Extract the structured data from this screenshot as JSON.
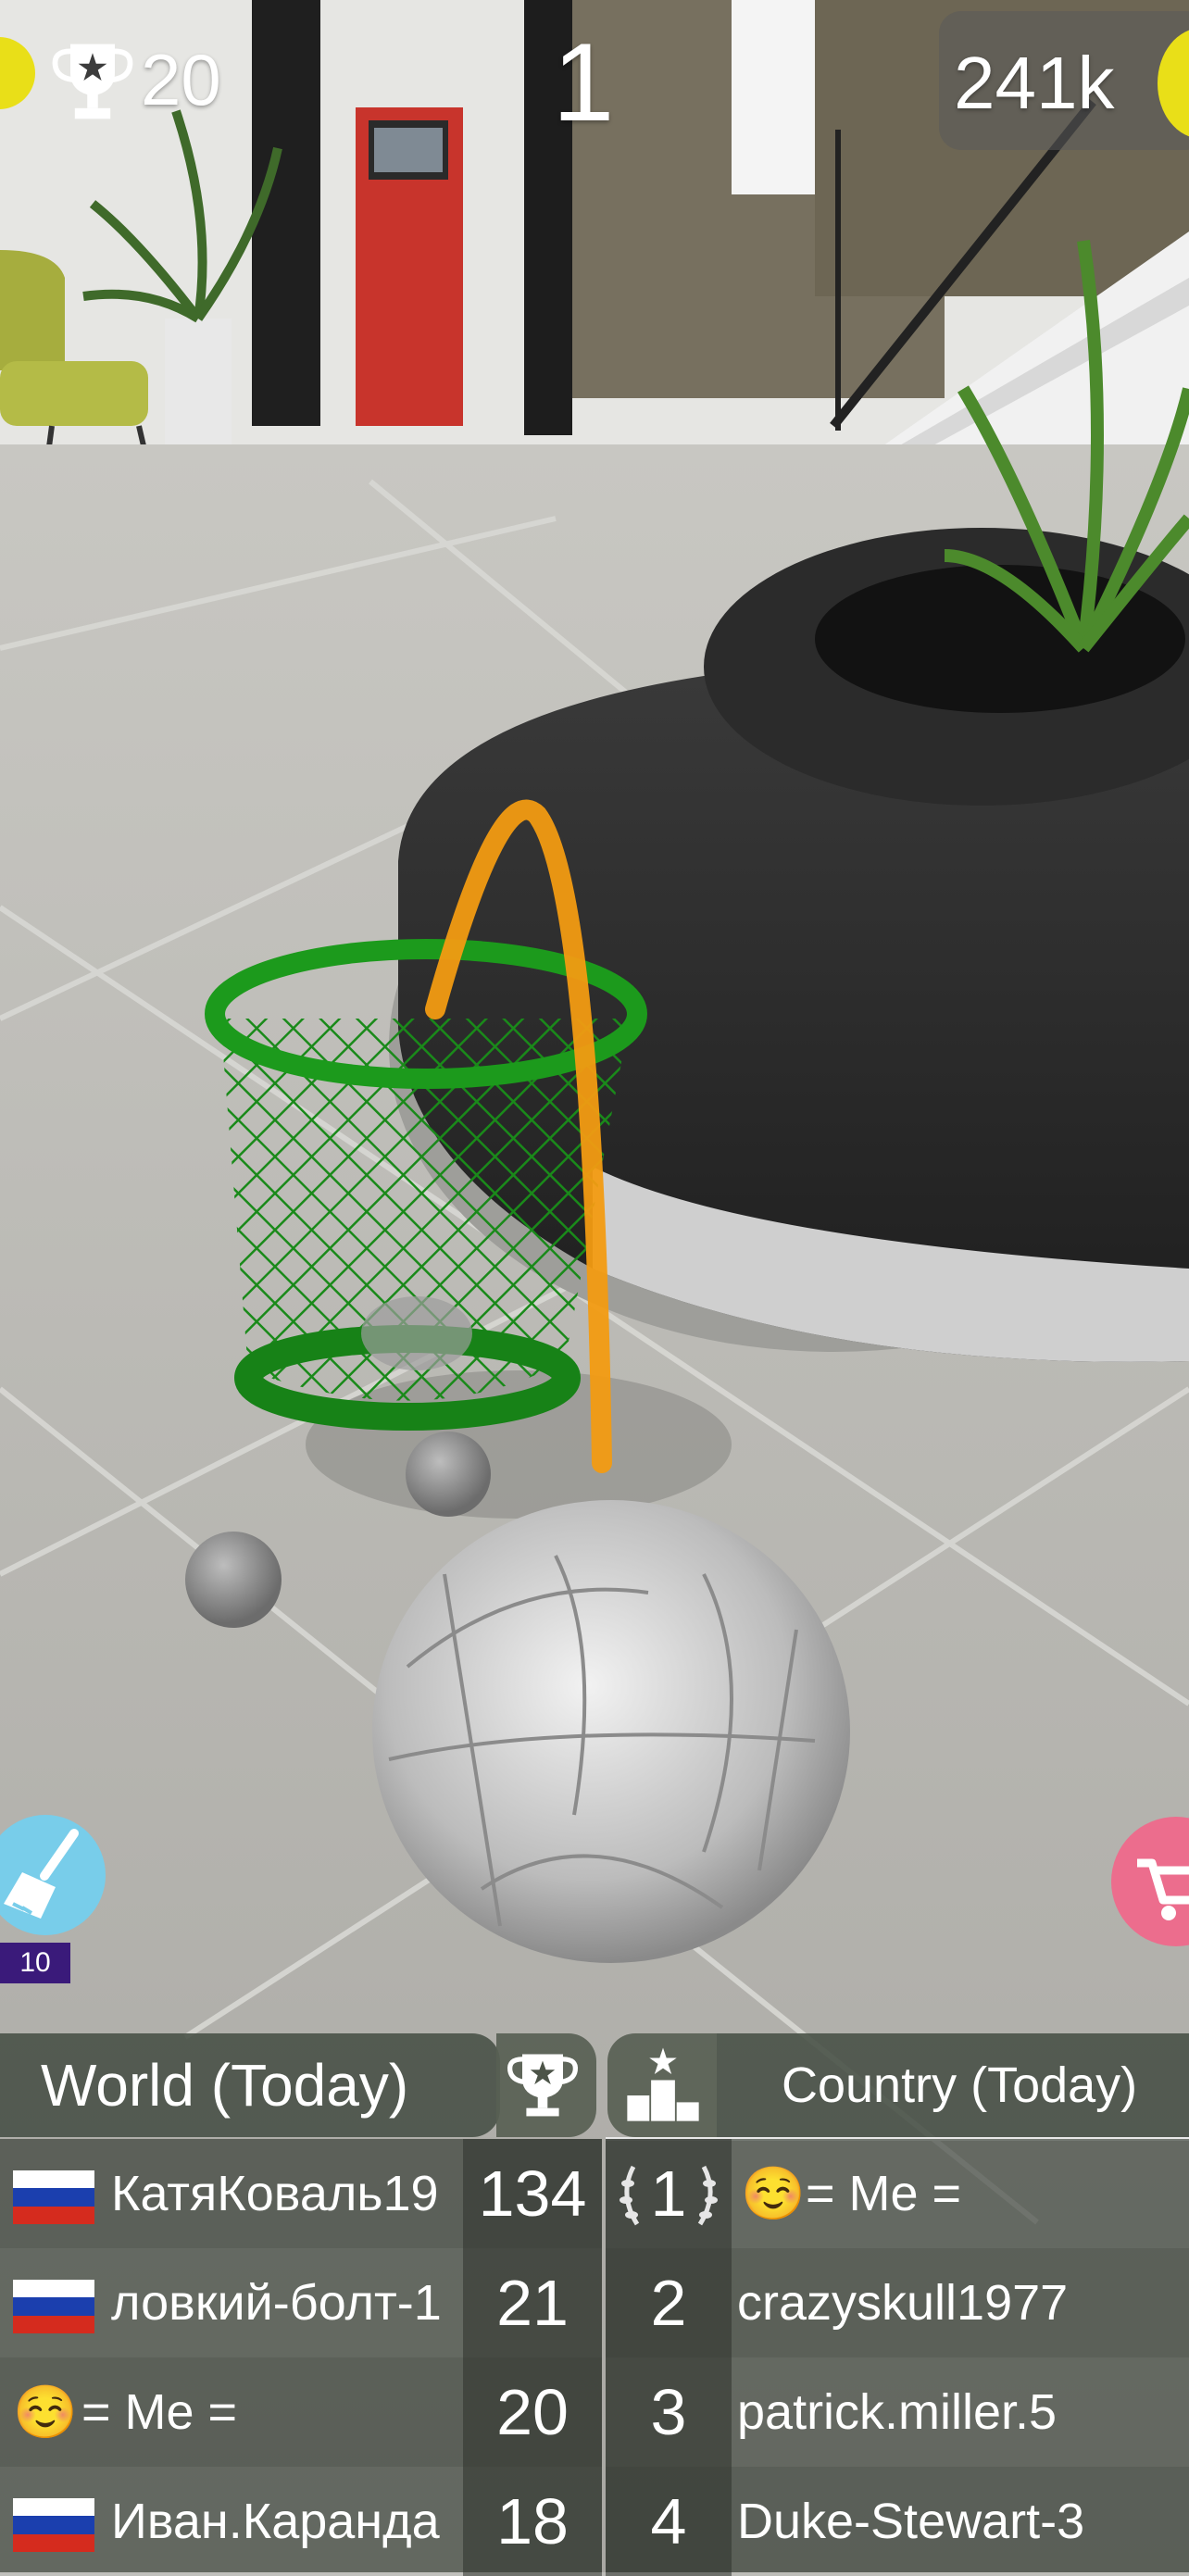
{
  "hud": {
    "best_score": "20",
    "current_score": "1",
    "coins": "241k",
    "cleanup_count": "10",
    "icons": [
      "trophy-icon",
      "coin-icon",
      "broom-icon",
      "cart-icon"
    ]
  },
  "colors": {
    "basket": "#1a8a1a",
    "trajectory": "#f29b12",
    "coin": "#e9df18",
    "broom_button": "#78cdea",
    "cart_button": "#ec6d8d",
    "panel": "#464e44"
  },
  "world_board": {
    "title": "World (Today)",
    "rows": [
      {
        "flag": "ru",
        "name": "КатяКоваль19",
        "score": "134"
      },
      {
        "flag": "ru",
        "name": "ловкий-болт-1",
        "score": "21"
      },
      {
        "emoji": "☺️",
        "name": "= Me =",
        "score": "20"
      },
      {
        "flag": "ru",
        "name": "Иван.Каранда",
        "score": "18"
      }
    ]
  },
  "country_board": {
    "title": "Country (Today)",
    "rows": [
      {
        "rank": "1",
        "emoji": "☺️",
        "name": "= Me ="
      },
      {
        "rank": "2",
        "name": "crazyskull1977"
      },
      {
        "rank": "3",
        "name": "patrick.miller.5"
      },
      {
        "rank": "4",
        "name": "Duke-Stewart-3"
      }
    ]
  }
}
